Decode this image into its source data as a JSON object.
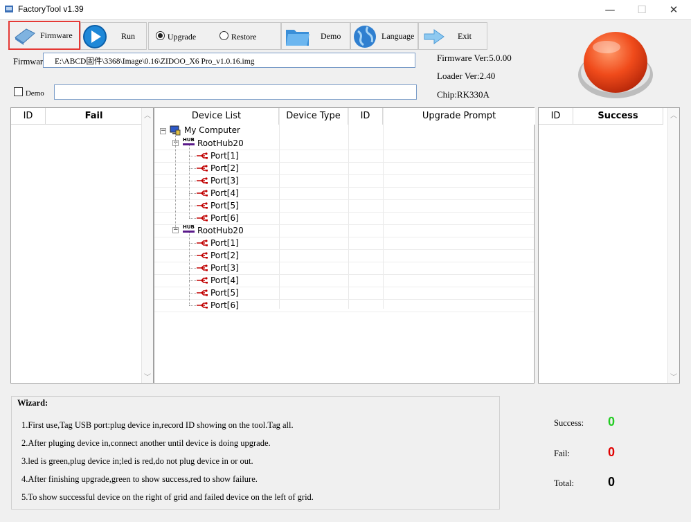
{
  "window": {
    "title": "FactoryTool v1.39"
  },
  "toolbar": {
    "firmware_label": "Firmware",
    "run_label": "Run",
    "upgrade_label": "Upgrade",
    "restore_label": "Restore",
    "demo_label": "Demo",
    "language_label": "Language",
    "exit_label": "Exit",
    "mode_selected": "Upgrade"
  },
  "firmware": {
    "label": "Firmware",
    "path": "E:\\ABCD固件\\3368\\Image\\0.16\\ZIDOO_X6 Pro_v1.0.16.img"
  },
  "demo": {
    "checkbox_label": "Demo",
    "checked": false,
    "path": ""
  },
  "info": {
    "firmware_ver": "Firmware Ver:5.0.00",
    "loader_ver": "Loader Ver:2.40",
    "chip": "Chip:RK330A"
  },
  "fail_panel": {
    "col_id": "ID",
    "col_fail": "Fail"
  },
  "success_panel": {
    "col_id": "ID",
    "col_success": "Success"
  },
  "device_list": {
    "columns": [
      "Device List",
      "Device Type",
      "ID",
      "Upgrade Prompt"
    ],
    "root": "My Computer",
    "hubs": [
      {
        "name": "RootHub20",
        "hub_badge": "HUB",
        "ports": [
          "Port[1]",
          "Port[2]",
          "Port[3]",
          "Port[4]",
          "Port[5]",
          "Port[6]"
        ]
      },
      {
        "name": "RootHub20",
        "hub_badge": "HUB",
        "ports": [
          "Port[1]",
          "Port[2]",
          "Port[3]",
          "Port[4]",
          "Port[5]",
          "Port[6]"
        ]
      }
    ]
  },
  "wizard": {
    "title": "Wizard:",
    "lines": [
      "1.First use,Tag USB port:plug device in,record ID showing on the tool.Tag all.",
      "2.After pluging device in,connect another until device is doing upgrade.",
      "3.led is green,plug device in;led is red,do not plug device in or out.",
      "4.After finishing upgrade,green to show success,red to show failure.",
      "5.To show successful device on the right of grid and failed device on the left of grid."
    ]
  },
  "stats": {
    "success_label": "Success:",
    "success_value": "0",
    "success_color": "#22cc22",
    "fail_label": "Fail:",
    "fail_value": "0",
    "fail_color": "#e00000",
    "total_label": "Total:",
    "total_value": "0",
    "total_color": "#000000"
  },
  "colors": {
    "highlight_red": "#e53935",
    "status_button": "#e8401c"
  }
}
